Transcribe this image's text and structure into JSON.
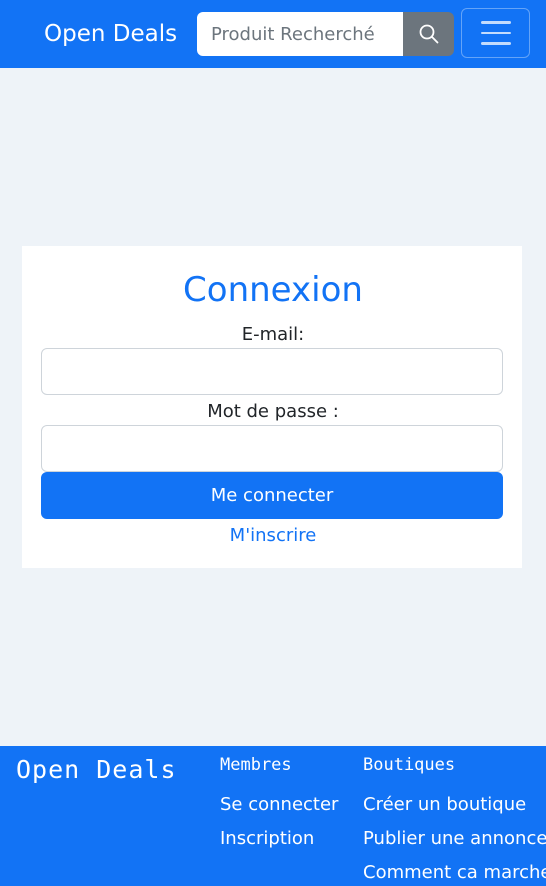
{
  "header": {
    "brand": "Open Deals",
    "search": {
      "placeholder": "Produit Recherché",
      "value": ""
    },
    "search_icon": "search-icon",
    "menu_icon": "hamburger-menu-icon"
  },
  "login": {
    "title": "Connexion",
    "email_label": "E-mail:",
    "email_value": "",
    "password_label": "Mot de passe :",
    "password_value": "",
    "submit_label": "Me connecter",
    "signup_label": "M'inscrire"
  },
  "footer": {
    "brand": "Open Deals",
    "members": {
      "heading": "Membres",
      "links": [
        "Se connecter",
        "Inscription"
      ]
    },
    "shops": {
      "heading": "Boutiques",
      "links": [
        "Créer un boutique",
        "Publier une annonce",
        "Comment ca marche"
      ]
    }
  },
  "colors": {
    "primary": "#1273f5",
    "background": "#eef3f8",
    "search_button": "#6c757d"
  }
}
